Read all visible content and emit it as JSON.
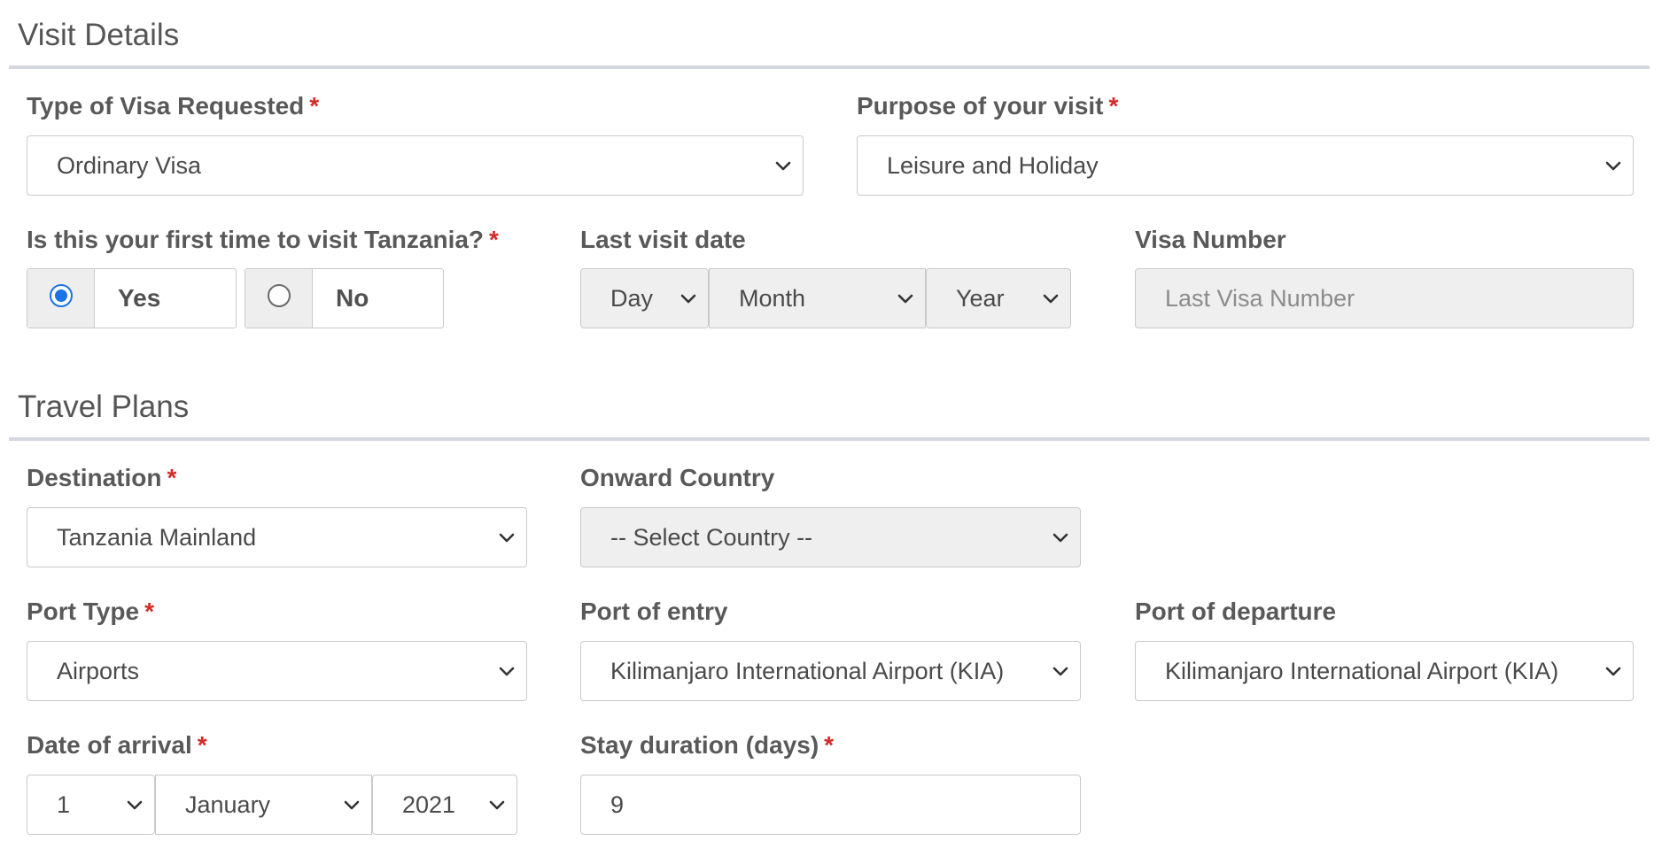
{
  "visit_details": {
    "title": "Visit Details",
    "visa_type": {
      "label": "Type of Visa Requested",
      "required": "*",
      "value": "Ordinary Visa"
    },
    "purpose": {
      "label": "Purpose of your visit",
      "required": "*",
      "value": "Leisure and Holiday"
    },
    "first_time": {
      "label": "Is this your first time to visit Tanzania?",
      "required": "*",
      "options": [
        {
          "label": "Yes",
          "checked": true
        },
        {
          "label": "No",
          "checked": false
        }
      ]
    },
    "last_visit": {
      "label": "Last visit date",
      "day": "Day",
      "month": "Month",
      "year": "Year"
    },
    "visa_number": {
      "label": "Visa Number",
      "placeholder": "Last Visa Number"
    }
  },
  "travel_plans": {
    "title": "Travel Plans",
    "destination": {
      "label": "Destination",
      "required": "*",
      "value": "Tanzania Mainland"
    },
    "onward_country": {
      "label": "Onward Country",
      "value": "-- Select Country --"
    },
    "port_type": {
      "label": "Port Type",
      "required": "*",
      "value": "Airports"
    },
    "port_of_entry": {
      "label": "Port of entry",
      "value": "Kilimanjaro International Airport (KIA)"
    },
    "port_of_departure": {
      "label": "Port of departure",
      "value": "Kilimanjaro International Airport (KIA)"
    },
    "date_of_arrival": {
      "label": "Date of arrival",
      "required": "*",
      "day": "1",
      "month": "January",
      "year": "2021"
    },
    "stay_duration": {
      "label": "Stay duration (days)",
      "required": "*",
      "value": "9"
    }
  },
  "icons": {
    "select_arrow": "chevron-down-icon",
    "radio_checked": "radio-checked-icon",
    "radio_unchecked": "radio-unchecked-icon"
  },
  "colors": {
    "required": "#d42a2a",
    "radio_selected": "#1a73e8",
    "section_rule": "#d4d6e0",
    "disabled_field": "#efefef"
  }
}
